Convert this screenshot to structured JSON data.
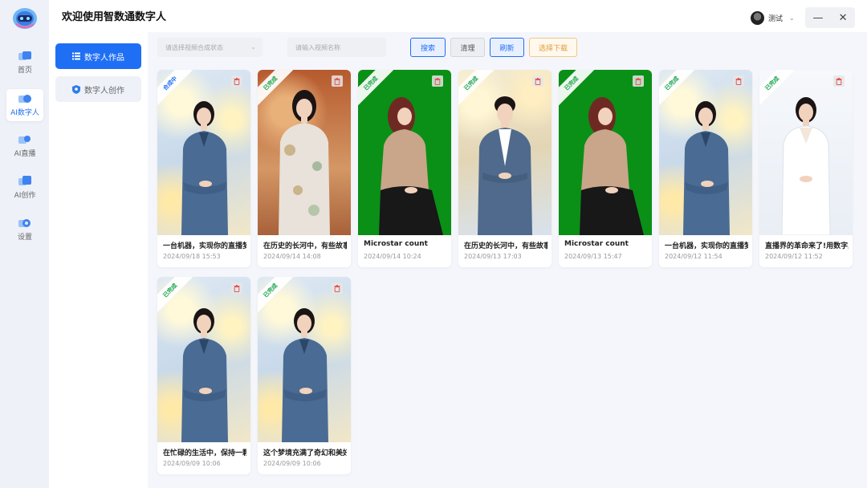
{
  "app": {
    "title": "欢迎使用智数通数字人"
  },
  "user": {
    "name": "测试"
  },
  "window_controls": {
    "minimize": "—",
    "close": "✕"
  },
  "rail": [
    {
      "label": "首页",
      "icon": "home-icon",
      "active": false
    },
    {
      "label": "AI数字人",
      "icon": "digital-human-icon",
      "active": true
    },
    {
      "label": "AI直播",
      "icon": "live-icon",
      "active": false
    },
    {
      "label": "AI创作",
      "icon": "create-icon",
      "active": false
    },
    {
      "label": "设置",
      "icon": "settings-icon",
      "active": false
    }
  ],
  "nav": {
    "works": "数字人作品",
    "create": "数字人创作"
  },
  "toolbar": {
    "status_placeholder": "请选择视频合成状态",
    "name_placeholder": "请输入视频名称",
    "search": "搜索",
    "clear": "清理",
    "refresh": "刷新",
    "download": "选择下载"
  },
  "cards": [
    {
      "title": "一台机器，实现你的直播梦想",
      "date": "2024/09/18 15:53",
      "status": "合成中",
      "bg": "bokeh",
      "figure": "woman-suit"
    },
    {
      "title": "在历史的长河中，有些故事",
      "date": "2024/09/14 14:08",
      "status": "已完成",
      "bg": "orange",
      "figure": "woman-qipao"
    },
    {
      "title": "Microstar count",
      "date": "2024/09/14 10:24",
      "status": "已完成",
      "bg": "green",
      "figure": "woman-green"
    },
    {
      "title": "在历史的长河中，有些故事",
      "date": "2024/09/13 17:03",
      "status": "已完成",
      "bg": "gold",
      "figure": "man-suit"
    },
    {
      "title": "Microstar count",
      "date": "2024/09/13 15:47",
      "status": "已完成",
      "bg": "green",
      "figure": "woman-green"
    },
    {
      "title": "一台机器，实现你的直播梦想",
      "date": "2024/09/12 11:54",
      "status": "已完成",
      "bg": "bokeh",
      "figure": "woman-suit"
    },
    {
      "title": "直播界的革命来了!用数字人",
      "date": "2024/09/12 11:52",
      "status": "已完成",
      "bg": "white",
      "figure": "woman-white"
    },
    {
      "title": "在忙碌的生活中，保持一颗",
      "date": "2024/09/09 10:06",
      "status": "已完成",
      "bg": "bokeh",
      "figure": "woman-suit"
    },
    {
      "title": "这个梦境充满了奇幻和美好",
      "date": "2024/09/09 10:06",
      "status": "已完成",
      "bg": "bokeh",
      "figure": "woman-suit"
    }
  ]
}
